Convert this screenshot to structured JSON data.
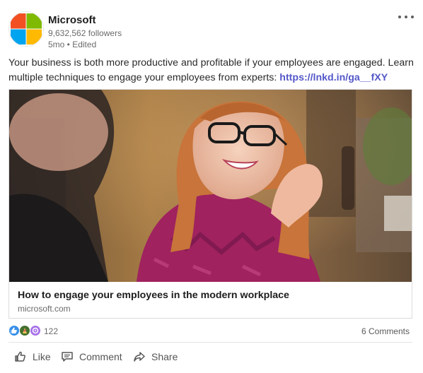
{
  "post": {
    "author": "Microsoft",
    "followers": "9,632,562 followers",
    "meta": "5mo • Edited",
    "text_main": "Your business is both more productive and profitable if your employees are engaged. Learn multiple techniques to engage your employees from experts: ",
    "link": "https://lnkd.in/ga__fXY",
    "more_icon": "ellipsis-icon"
  },
  "logo": {
    "colors": [
      "#f25022",
      "#7fba00",
      "#00a4ef",
      "#ffb900"
    ]
  },
  "article": {
    "title": "How to engage your employees in the modern workplace",
    "source": "microsoft.com"
  },
  "social": {
    "reaction_count": "122",
    "comments": "6 Comments",
    "reaction_icons": [
      "like-reaction-icon",
      "celebrate-reaction-icon",
      "curious-reaction-icon"
    ]
  },
  "actions": {
    "like": "Like",
    "comment": "Comment",
    "share": "Share"
  }
}
